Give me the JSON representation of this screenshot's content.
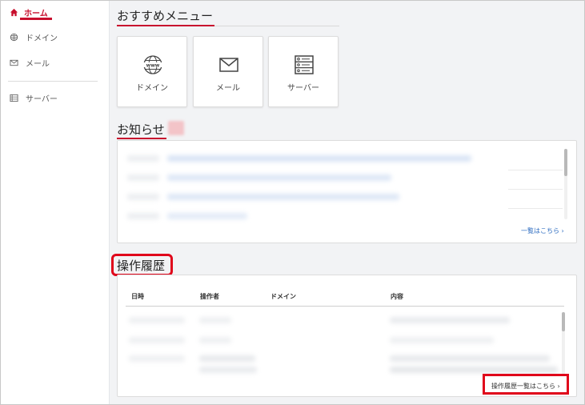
{
  "sidebar": {
    "items": [
      {
        "label": "ホーム",
        "icon": "home-icon"
      },
      {
        "label": "ドメイン",
        "icon": "globe-icon"
      },
      {
        "label": "メール",
        "icon": "mail-icon"
      },
      {
        "label": "サーバー",
        "icon": "server-list-icon"
      }
    ],
    "active_color": "#c8102e"
  },
  "recommended": {
    "title": "おすすめメニュー",
    "cards": [
      {
        "label": "ドメイン",
        "icon": "www-globe-icon"
      },
      {
        "label": "メール",
        "icon": "envelope-icon"
      },
      {
        "label": "サーバー",
        "icon": "server-icon"
      }
    ]
  },
  "news": {
    "title": "お知らせ",
    "more_link": "一覧はこちら ›"
  },
  "history": {
    "title": "操作履歴",
    "columns": [
      "日時",
      "操作者",
      "ドメイン",
      "内容"
    ],
    "more_link": "操作履歴一覧はこちら ›"
  },
  "colors": {
    "accent": "#c8102e",
    "highlight": "#e0061b",
    "link": "#2d6cc0"
  }
}
